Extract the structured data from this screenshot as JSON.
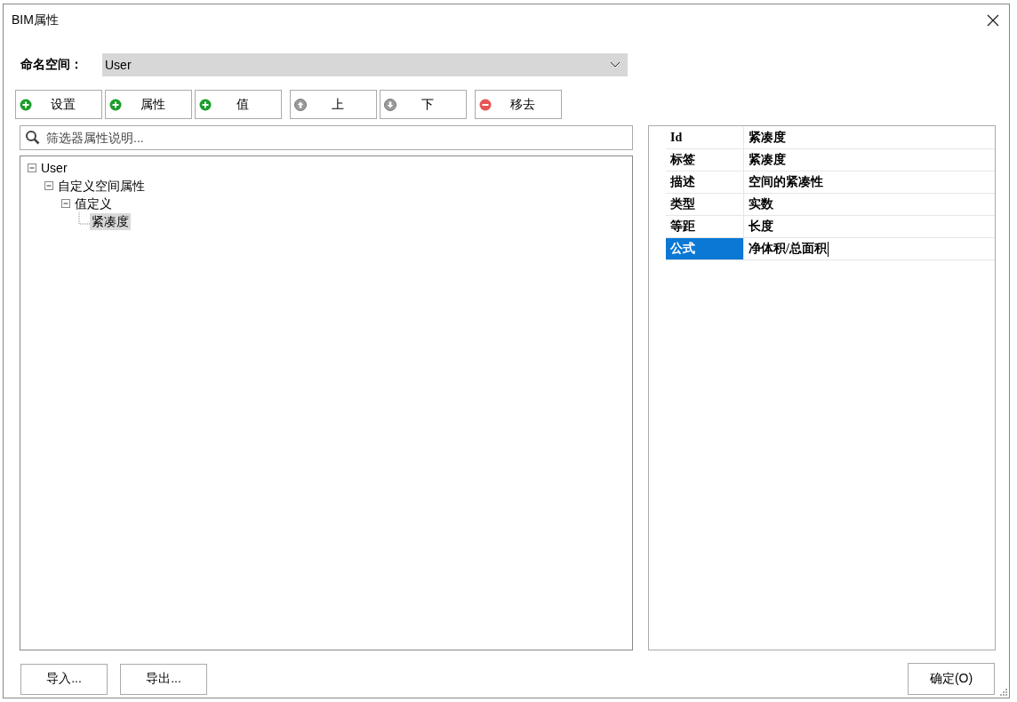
{
  "window": {
    "title": "BIM属性"
  },
  "namespace": {
    "label": "命名空间：",
    "value": "User"
  },
  "toolbar": [
    {
      "label": "设置",
      "kind": "add"
    },
    {
      "label": "属性",
      "kind": "add"
    },
    {
      "label": "值",
      "kind": "add"
    },
    {
      "label": "上",
      "kind": "up"
    },
    {
      "label": "下",
      "kind": "down"
    },
    {
      "label": "移去",
      "kind": "remove"
    }
  ],
  "search": {
    "placeholder": "筛选器属性说明..."
  },
  "tree": [
    {
      "label": "User",
      "expanded": true,
      "selected": false,
      "children": [
        {
          "label": "自定义空间属性",
          "expanded": true,
          "selected": false,
          "children": [
            {
              "label": "值定义",
              "expanded": true,
              "selected": false,
              "children": [
                {
                  "label": "紧凑度",
                  "selected": true
                }
              ]
            }
          ]
        }
      ]
    }
  ],
  "properties": [
    {
      "name": "Id",
      "value": "紧凑度",
      "selected": false
    },
    {
      "name": "标签",
      "value": "紧凑度",
      "selected": false
    },
    {
      "name": "描述",
      "value": "空间的紧凑性",
      "selected": false
    },
    {
      "name": "类型",
      "value": "实数",
      "selected": false
    },
    {
      "name": "等距",
      "value": "长度",
      "selected": false
    },
    {
      "name": "公式",
      "value": "净体积/总面积",
      "selected": true
    }
  ],
  "footer_buttons": [
    "导入...",
    "导出..."
  ],
  "ok_button": "确定(O)"
}
